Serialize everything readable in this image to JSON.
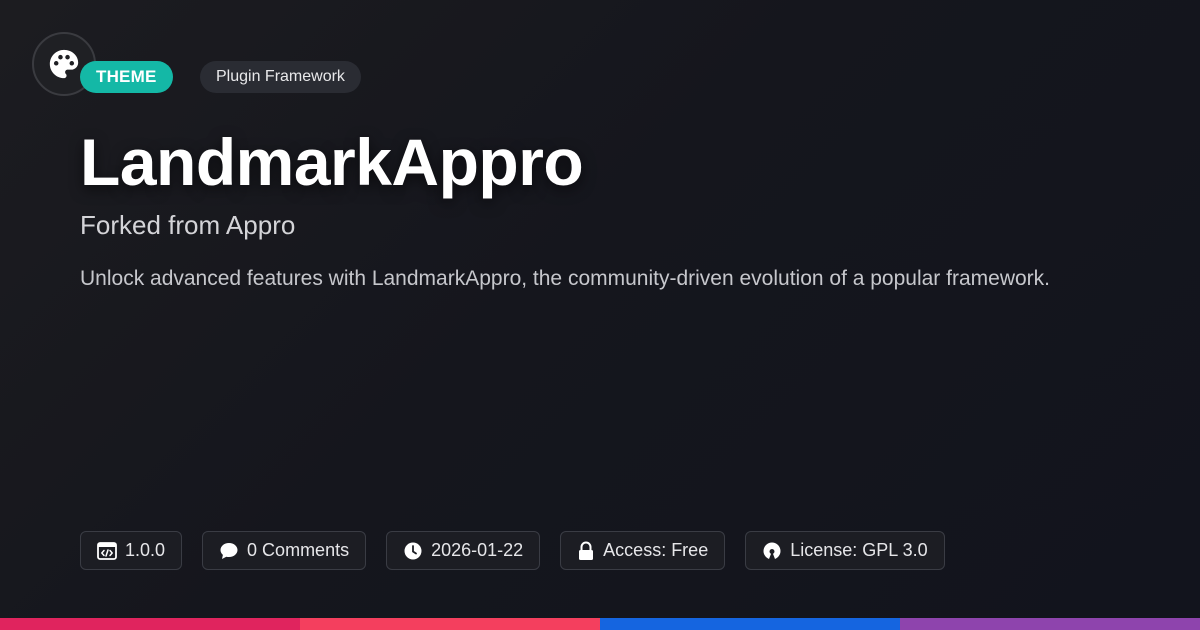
{
  "header": {
    "logo_icon": "palette-icon",
    "type_badge": "THEME",
    "category_badge": "Plugin Framework"
  },
  "main": {
    "title": "LandmarkAppro",
    "subtitle": "Forked from Appro",
    "description": "Unlock advanced features with LandmarkAppro, the community-driven evolution of a popular framework."
  },
  "meta": {
    "version": "1.0.0",
    "comments": "0 Comments",
    "date": "2026-01-22",
    "access": "Access: Free",
    "license": "License: GPL 3.0"
  },
  "colors": {
    "accent_teal": "#14b8a6",
    "stripe_1": "#e0245e",
    "stripe_2": "#f43f5e",
    "stripe_3": "#1565e0",
    "stripe_4": "#8e44ad"
  }
}
